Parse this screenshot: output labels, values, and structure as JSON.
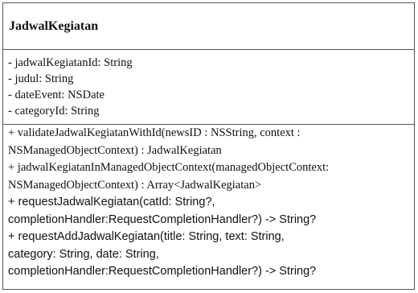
{
  "class_name": "JadwalKegiatan",
  "attributes": [
    "- jadwalKegiatanId: String",
    "- judul: String",
    "- dateEvent: NSDate",
    "- categoryId: String"
  ],
  "methods": [
    "+ validateJadwalKegiatanWithId(newsID : NSString, context :",
    "NSManagedObjectContext) : JadwalKegiatan",
    "+ jadwalKegiatanInManagedObjectContext(managedObjectContext:",
    "NSManagedObjectContext) : Array<JadwalKegiatan>",
    "+ requestJadwalKegiatan(catId: String?,",
    "completionHandler:RequestCompletionHandler?) -> String?",
    "+ requestAddJadwalKegiatan(title: String, text: String,",
    "category: String, date: String,",
    "completionHandler:RequestCompletionHandler?) -> String?"
  ]
}
